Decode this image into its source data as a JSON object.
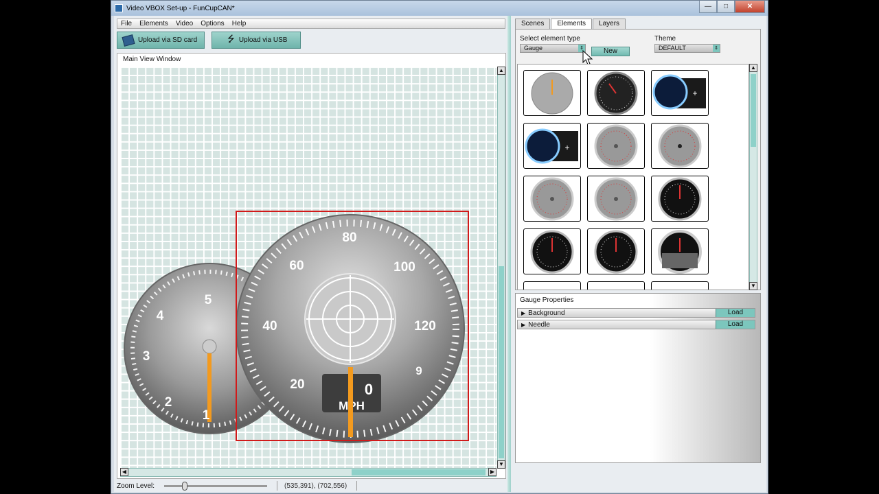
{
  "window": {
    "title": "Video VBOX Set-up - FunCupCAN*",
    "buttons": {
      "minimize": "—",
      "maximize": "□",
      "close": "✕"
    }
  },
  "menu": {
    "items": [
      "File",
      "Elements",
      "Video",
      "Options",
      "Help"
    ]
  },
  "toolbar": {
    "upload_sd": "Upload via SD card",
    "upload_usb": "Upload via USB"
  },
  "main_view": {
    "label": "Main View Window"
  },
  "gauges": {
    "left": {
      "labels": [
        "1",
        "2",
        "3",
        "4",
        "5"
      ]
    },
    "right": {
      "labels": [
        "20",
        "40",
        "60",
        "80",
        "100",
        "120"
      ],
      "extra_label": "9",
      "digital_value": "0",
      "unit": "MPH"
    }
  },
  "status": {
    "zoom_label": "Zoom Level:",
    "zoom_level": 0.18,
    "coords": "(535,391), (702,556)"
  },
  "tabs": [
    {
      "label": "Scenes"
    },
    {
      "label": "Elements",
      "active": true
    },
    {
      "label": "Layers"
    }
  ],
  "elements_panel": {
    "select_type_label": "Select element type",
    "element_type": "Gauge",
    "new_button": "New",
    "theme_label": "Theme",
    "theme": "DEFAULT"
  },
  "gauge_properties": {
    "title": "Gauge Properties",
    "rows": [
      {
        "label": "Background",
        "action": "Load"
      },
      {
        "label": "Needle",
        "action": "Load"
      }
    ]
  },
  "colors": {
    "teal": "#7cc6bd",
    "needle": "#f39a1e",
    "selection": "#d11a1a"
  }
}
